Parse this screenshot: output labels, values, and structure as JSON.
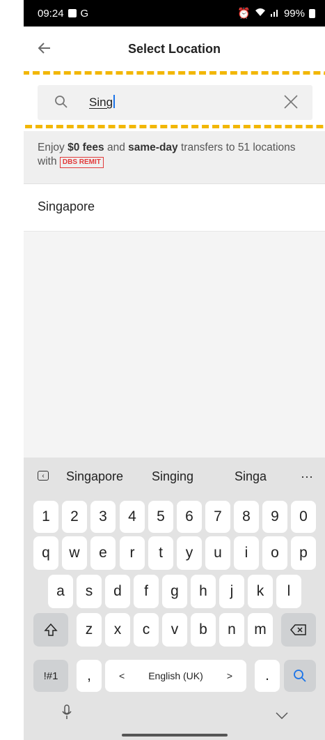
{
  "status_bar": {
    "time": "09:24",
    "battery": "99%"
  },
  "header": {
    "title": "Select Location"
  },
  "search": {
    "value": "Sing"
  },
  "promo": {
    "text_1": "Enjoy ",
    "bold_1": "$0 fees",
    "text_2": " and ",
    "bold_2": "same-day",
    "text_3": " transfers to 51 locations with ",
    "badge": "DBS REMIT"
  },
  "results": [
    {
      "label": "Singapore"
    }
  ],
  "keyboard": {
    "suggestions": [
      "Singapore",
      "Singing",
      "Singa"
    ],
    "more": "···",
    "number_row": [
      "1",
      "2",
      "3",
      "4",
      "5",
      "6",
      "7",
      "8",
      "9",
      "0"
    ],
    "row1": [
      "q",
      "w",
      "e",
      "r",
      "t",
      "y",
      "u",
      "i",
      "o",
      "p"
    ],
    "row2": [
      "a",
      "s",
      "d",
      "f",
      "g",
      "h",
      "j",
      "k",
      "l"
    ],
    "row3": [
      "z",
      "x",
      "c",
      "v",
      "b",
      "n",
      "m"
    ],
    "symbols_key": "!#1",
    "comma_key": ",",
    "space_label": "English (UK)",
    "space_left": "<",
    "space_right": ">",
    "period_key": "."
  },
  "colors": {
    "highlight": "#f2b705",
    "badge": "#e23a3a",
    "accent": "#1a73e8"
  }
}
